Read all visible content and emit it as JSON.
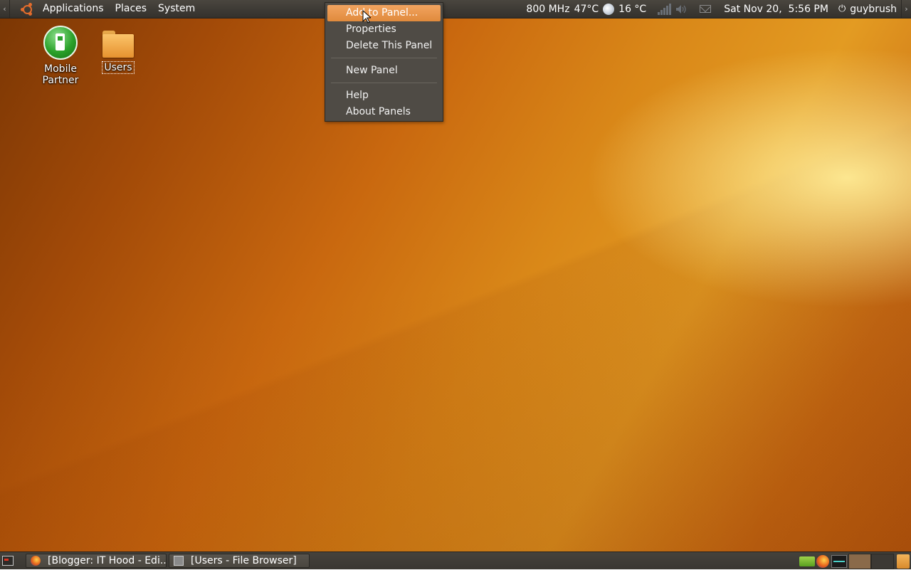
{
  "top_panel": {
    "menus": [
      "Applications",
      "Places",
      "System"
    ],
    "hide_left": "‹",
    "hide_right": "›",
    "tray": {
      "cpu_freq": "800 MHz",
      "cpu_temp": "47°C",
      "weather_temp": "16 °C",
      "datetime": "Sat Nov 20,  5:56 PM",
      "user": "guybrush"
    }
  },
  "desktop": {
    "icons": [
      {
        "label": "Mobile Partner"
      },
      {
        "label": "Users"
      }
    ]
  },
  "context_menu": {
    "items": [
      {
        "label": "Add to Panel...",
        "active": true
      },
      {
        "label": "Properties"
      },
      {
        "label": "Delete This Panel"
      },
      {
        "label": "New Panel"
      },
      {
        "label": "Help"
      },
      {
        "label": "About Panels"
      }
    ]
  },
  "bottom_panel": {
    "tasks": [
      {
        "label": "[Blogger: IT Hood - Edi..."
      },
      {
        "label": "[Users - File Browser]"
      }
    ]
  }
}
